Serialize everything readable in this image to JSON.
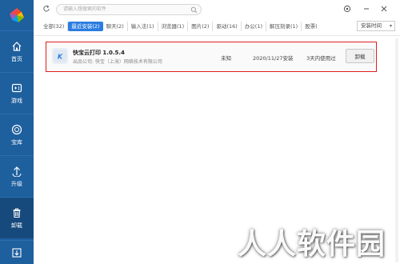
{
  "sidebar": {
    "items": [
      {
        "label": "首页",
        "icon": "home-icon"
      },
      {
        "label": "游戏",
        "icon": "gamepad-icon"
      },
      {
        "label": "宝库",
        "icon": "treasure-icon"
      },
      {
        "label": "升级",
        "icon": "upgrade-icon"
      },
      {
        "label": "卸载",
        "icon": "trash-icon"
      }
    ],
    "active_index": 4
  },
  "search": {
    "placeholder": "请输入想搜索的软件"
  },
  "tabs": [
    {
      "label": "全部(32)"
    },
    {
      "label": "最近安装(2)"
    },
    {
      "label": "聊天(2)"
    },
    {
      "label": "输入法(1)"
    },
    {
      "label": "浏览器(1)"
    },
    {
      "label": "图片(2)"
    },
    {
      "label": "驱动(16)"
    },
    {
      "label": "办公(1)"
    },
    {
      "label": "解压刻录(1)"
    },
    {
      "label": "股票("
    }
  ],
  "active_tab": 1,
  "sort": {
    "label": "安装时间"
  },
  "app": {
    "name": "快宝云打印 1.0.5.4",
    "publisher": "出品公司: 快宝（上海）网络技术有限公司",
    "size": "未知",
    "install_date": "2020/11/27安装",
    "usage": "3天内使用过",
    "uninstall_label": "卸载"
  },
  "watermark": "人人软件园",
  "colors": {
    "sidebar": "#1e5f9e",
    "accent": "#2b7de1",
    "highlight_border": "#e01f1f"
  }
}
